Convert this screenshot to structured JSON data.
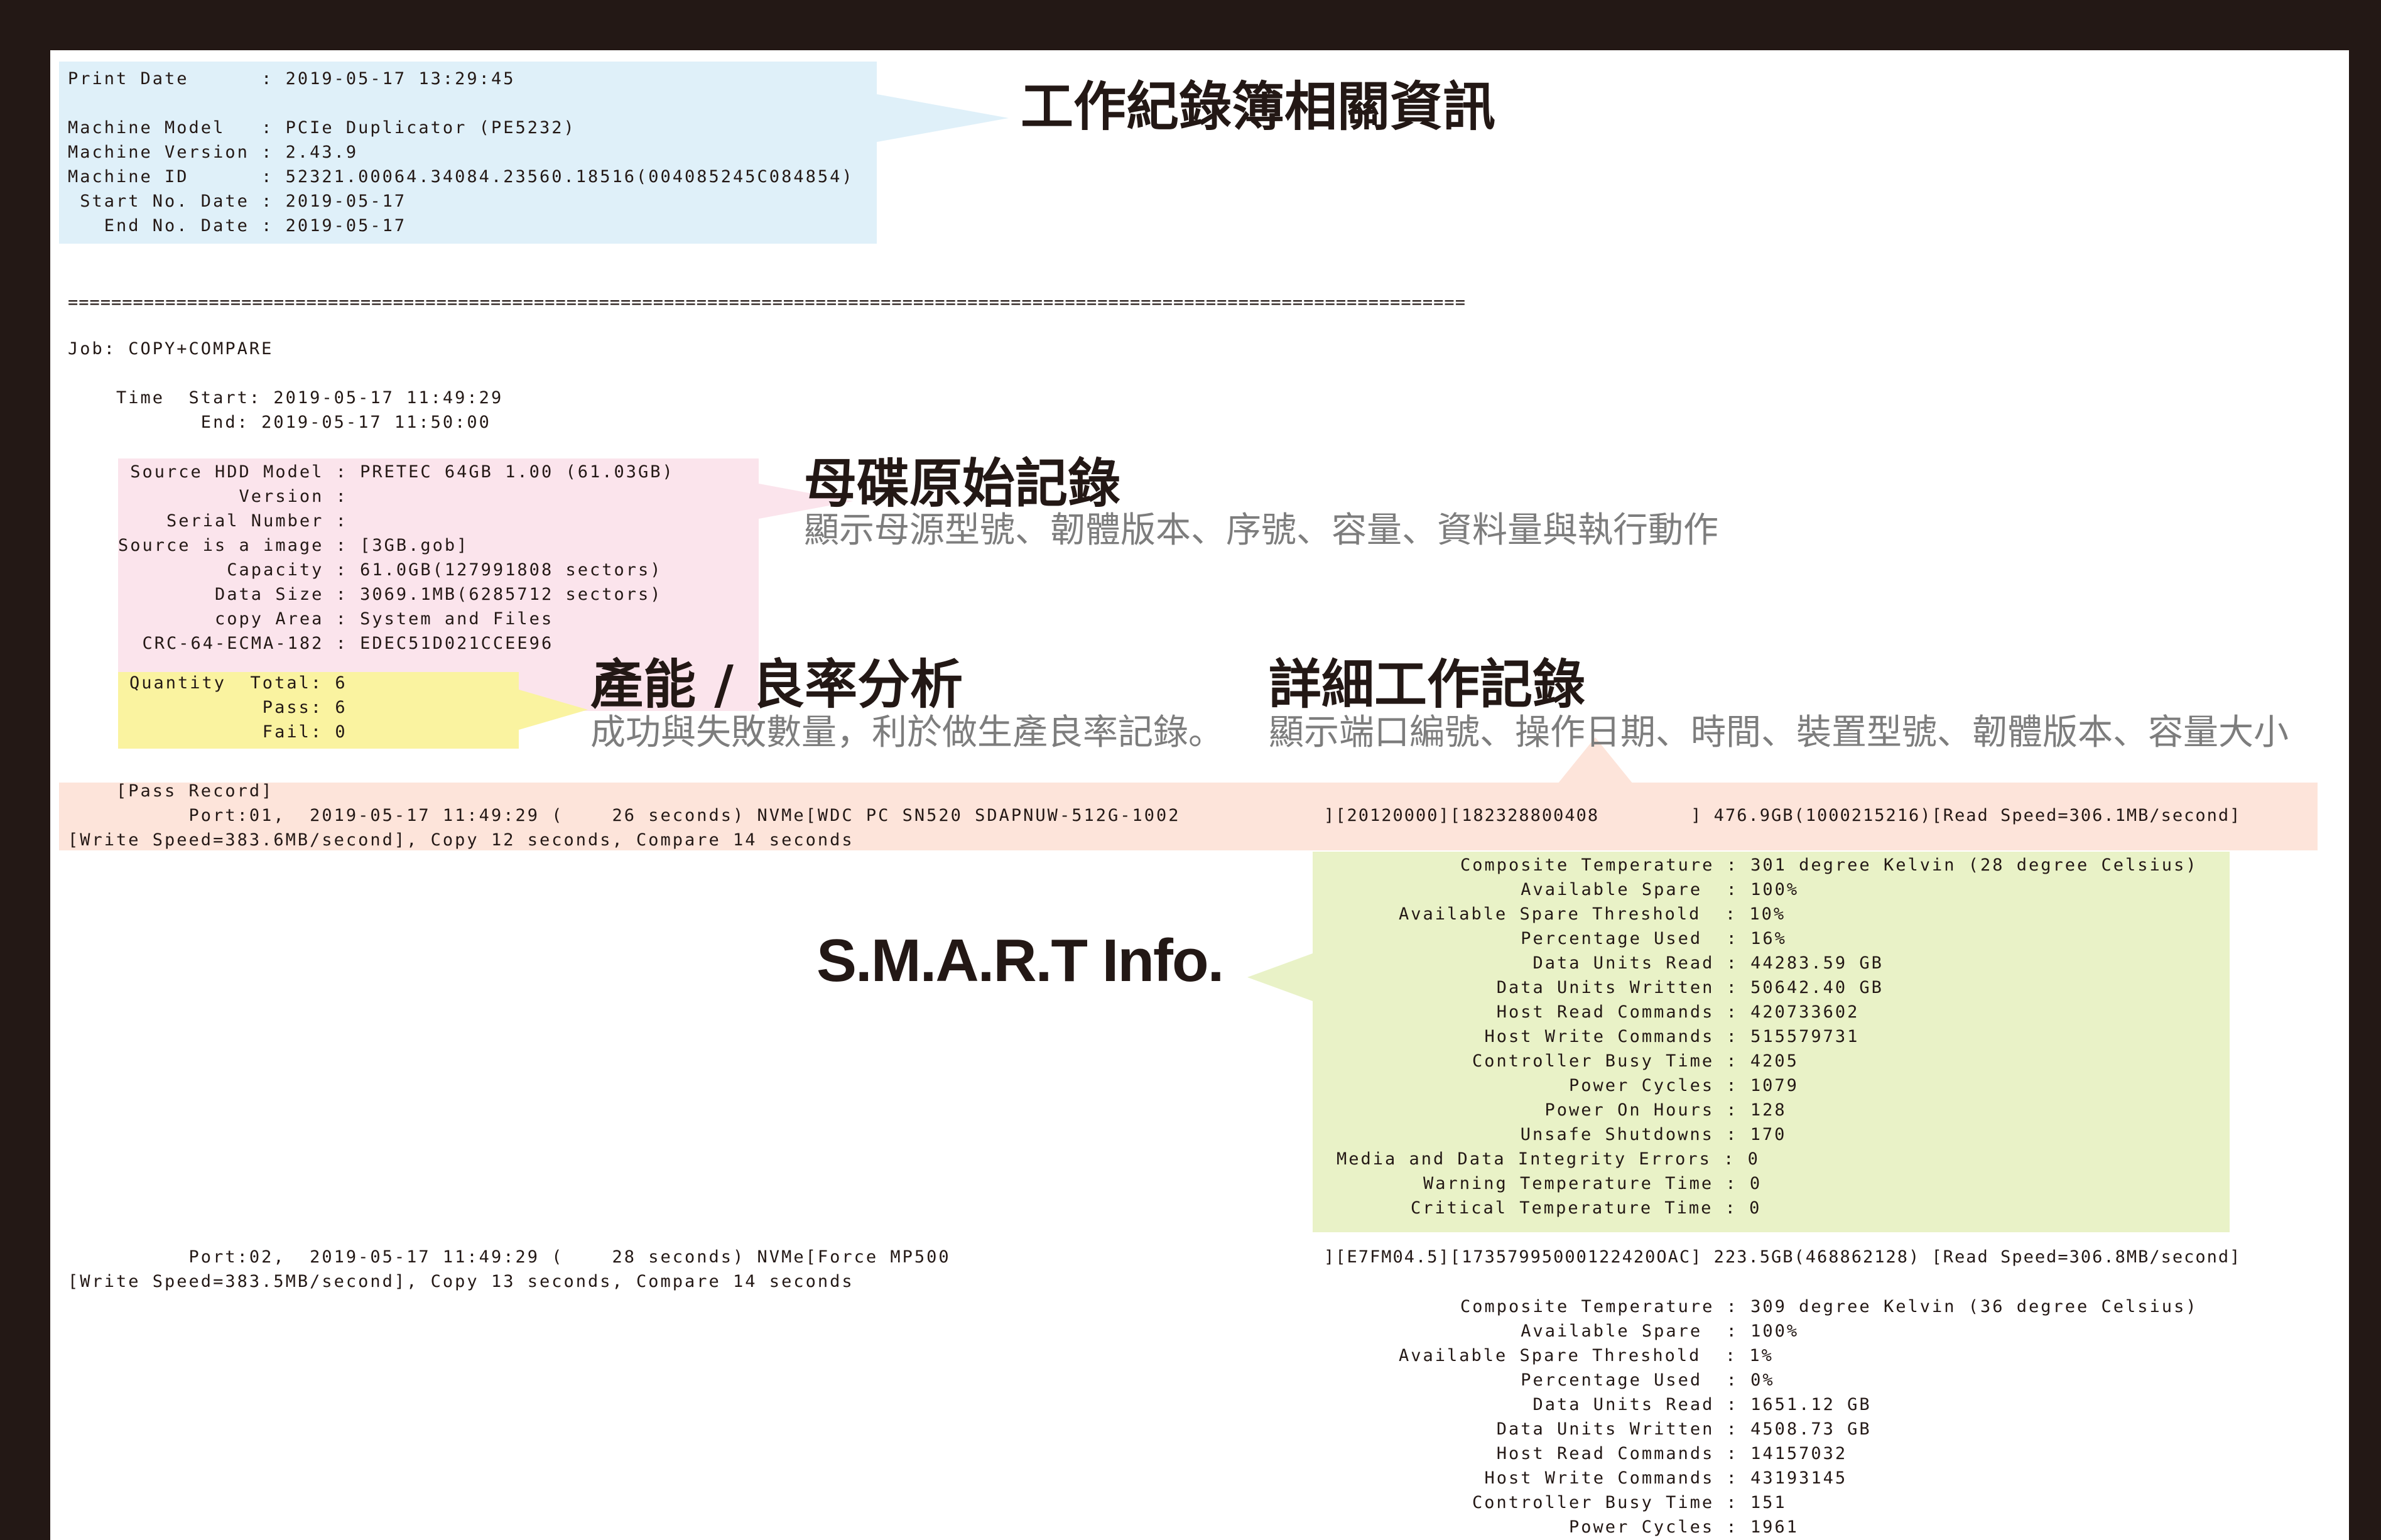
{
  "header": {
    "print_date": "Print Date      : 2019-05-17 13:29:45",
    "machine_model": "Machine Model   : PCIe Duplicator (PE5232)",
    "machine_version": "Machine Version : 2.43.9",
    "machine_id": "Machine ID      : 52321.00064.34084.23560.18516(004085245C084854)",
    "start_no_date": " Start No. Date : 2019-05-17",
    "end_no_date": "   End No. Date : 2019-05-17"
  },
  "separator": "=================================================================================================================================",
  "job": {
    "label": "Job: COPY+COMPARE",
    "time_start": "    Time  Start: 2019-05-17 11:49:29",
    "time_end": "           End: 2019-05-17 11:50:00"
  },
  "source": {
    "model": " Source HDD Model : PRETEC 64GB 1.00 (61.03GB)",
    "version": "          Version :",
    "serial": "    Serial Number :",
    "image": "Source is a image : [3GB.gob]",
    "capacity": "         Capacity : 61.0GB(127991808 sectors)",
    "data_size": "        Data Size : 3069.1MB(6285712 sectors)",
    "copy_area": "        copy Area : System and Files",
    "crc": "  CRC-64-ECMA-182 : EDEC51D021CCEE96"
  },
  "quantity": {
    "total": "Quantity  Total: 6",
    "pass": "           Pass: 6",
    "fail": "           Fail: 0"
  },
  "record": {
    "label": "    [Pass Record]",
    "port1_a": "          Port:01,  2019-05-17 11:49:29 (    26 seconds) NVMe[WDC PC SN520 SDAPNUW-512G-1002",
    "port1_b": "][20120000][182328800408        ] 476.9GB(1000215216)[Read Speed=306.1MB/second]",
    "port1_c": "[Write Speed=383.6MB/second], Copy 12 seconds, Compare 14 seconds",
    "port2_a": "          Port:02,  2019-05-17 11:49:29 (    28 seconds) NVMe[Force MP500",
    "port2_b": "][E7FM04.5][17357995000122420OAC] 223.5GB(468862128) [Read Speed=306.8MB/second]",
    "port2_c": "[Write Speed=383.5MB/second], Copy 13 seconds, Compare 14 seconds"
  },
  "smart1": [
    "Composite Temperature : 301 degree Kelvin (28 degree Celsius)",
    "     Available Spare  : 100%",
    "Available Spare Threshold  : 10%",
    "     Percentage Used  : 16%",
    "      Data Units Read : 44283.59 GB",
    "   Data Units Written : 50642.40 GB",
    "   Host Read Commands : 420733602",
    "  Host Write Commands : 515579731",
    "Controller Busy Time : 4205",
    "        Power Cycles : 1079",
    "      Power On Hours : 128",
    "   Unsafe Shutdowns : 170",
    "Media and Data Integrity Errors : 0",
    "Warning Temperature Time : 0",
    "Critical Temperature Time : 0"
  ],
  "smart2": [
    "Composite Temperature : 309 degree Kelvin (36 degree Celsius)",
    "     Available Spare  : 100%",
    "Available Spare Threshold  : 1%",
    "     Percentage Used  : 0%",
    "      Data Units Read : 1651.12 GB",
    "   Data Units Written : 4508.73 GB",
    "   Host Read Commands : 14157032",
    "  Host Write Commands : 43193145",
    "Controller Busy Time : 151",
    "        Power Cycles : 1961"
  ],
  "annotations": {
    "workbook_title": "工作紀錄簿相關資訊",
    "master_title": "母碟原始記錄",
    "master_sub": "顯示母源型號、韌體版本、序號、容量、資料量與執行動作",
    "yield_title": "產能 / 良率分析",
    "yield_sub": "成功與失敗數量，利於做生產良率記錄。",
    "detail_title": "詳細工作記錄",
    "detail_sub": "顯示端口編號、操作日期、時間、裝置型號、韌體版本、容量大小",
    "smart_title": "S.M.A.R.T Info."
  },
  "colors": {
    "frame": "#231815",
    "paper": "#ffffff",
    "blue_highlight": "#dff0f9",
    "pink_highlight": "#fbe4ec",
    "yellow_highlight": "#faf3a0",
    "peach_highlight": "#fde4da",
    "green_highlight": "#e9f2c7"
  }
}
